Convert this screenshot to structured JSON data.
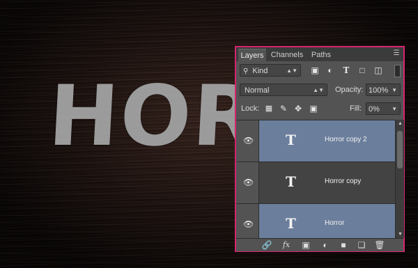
{
  "canvas": {
    "text": "HORR"
  },
  "panel": {
    "tabs": [
      "Layers",
      "Channels",
      "Paths"
    ],
    "active_tab": "Layers",
    "filter": {
      "kind_label": "Kind",
      "icons": [
        "image-filter-icon",
        "adjustment-filter-icon",
        "type-filter-icon",
        "shape-filter-icon",
        "smart-object-filter-icon"
      ]
    },
    "blend": {
      "mode": "Normal",
      "opacity_label": "Opacity:",
      "opacity": "100%"
    },
    "lock": {
      "label": "Lock:",
      "fill_label": "Fill:",
      "fill": "0%"
    },
    "layers": [
      {
        "name": "Horror copy 2",
        "selected": true
      },
      {
        "name": "Horror copy",
        "selected": false
      },
      {
        "name": "Horror",
        "selected": true
      }
    ],
    "type_glyph": "T",
    "accent_border": "#d6246d",
    "selected_color": "#6b7e9c"
  }
}
